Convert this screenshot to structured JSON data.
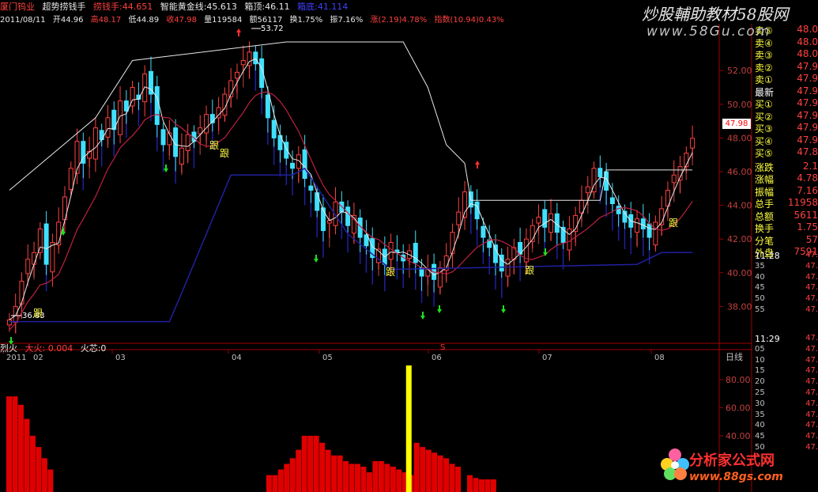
{
  "header": {
    "stock_name": "厦门钨业",
    "indicator_name": "超势捞钱手",
    "lao_qian_shou": "捞钱手:44.651",
    "zhineng_huangjin": "智能黄金线:45.613",
    "xiang_ding": "箱顶:46.11",
    "extra": "箱底:41.114"
  },
  "quote_line": {
    "date": "2011/08/11",
    "open": "开44.96",
    "high": "高48.17",
    "low": "低44.89",
    "close": "收47.98",
    "volume": "量119584",
    "amount": "额56117",
    "turnover": "换1.75%",
    "amplitude": "振7.16%",
    "change": "涨(2.19)4.78%",
    "index": "指数(10.94)0.43%"
  },
  "watermarks": {
    "top_cn": "炒股輔助教材58股网",
    "top_url": "www.58Gu.com",
    "bottom_cn": "分析家公式网",
    "bottom_url": "www.88gs.com"
  },
  "chart_labels": {
    "high_annot": "53.72",
    "low_annot": "36.83",
    "current_price_tag": "47.98",
    "period_label": "日线",
    "gen_label": "跟",
    "sell_mark": "S"
  },
  "lower_header": {
    "name": "烈火",
    "sub": "大火: 0.004",
    "core": "火芯:0"
  },
  "colors": {
    "up": "#ff4040",
    "down": "#40e0ff",
    "background": "#000000",
    "axis": "#a00000",
    "blue_line": "#2020a0",
    "white_line": "#e8e8e8",
    "red_bar": "#e00000",
    "yellow_bar": "#ffff00"
  },
  "quote_panel": {
    "asks": [
      {
        "label": "卖⑤",
        "value": "48.0"
      },
      {
        "label": "卖④",
        "value": "48.0"
      },
      {
        "label": "卖③",
        "value": "48.0"
      },
      {
        "label": "卖②",
        "value": "47.9"
      },
      {
        "label": "卖①",
        "value": "47.9"
      }
    ],
    "last": {
      "label": "最新",
      "value": "47.9"
    },
    "bids": [
      {
        "label": "买①",
        "value": "47.9"
      },
      {
        "label": "买②",
        "value": "47.9"
      },
      {
        "label": "买③",
        "value": "47.9"
      },
      {
        "label": "买④",
        "value": "47.9"
      },
      {
        "label": "买⑤",
        "value": "47.8"
      }
    ],
    "stats": [
      {
        "label": "涨跌",
        "value": "2.1"
      },
      {
        "label": "涨幅",
        "value": "4.78"
      },
      {
        "label": "振幅",
        "value": "7.16"
      },
      {
        "label": "总手",
        "value": "11958"
      },
      {
        "label": "总额",
        "value": "5611"
      },
      {
        "label": "换手",
        "value": "1.75"
      },
      {
        "label": "分笔",
        "value": "57"
      },
      {
        "label": "外盘",
        "value": "7591"
      }
    ],
    "ticks1_time": "11:28",
    "ticks1": [
      {
        "label": "",
        "value": "47."
      },
      {
        "label": "35",
        "value": "47."
      },
      {
        "label": "40",
        "value": "47."
      },
      {
        "label": "45",
        "value": "47."
      },
      {
        "label": "50",
        "value": "47."
      },
      {
        "label": "55",
        "value": "47."
      }
    ],
    "ticks2_time": "11:29",
    "ticks2": [
      {
        "label": "",
        "value": "47."
      },
      {
        "label": "05",
        "value": "47."
      },
      {
        "label": "10",
        "value": "47."
      },
      {
        "label": "15",
        "value": "47."
      },
      {
        "label": "20",
        "value": "47."
      },
      {
        "label": "25",
        "value": "47."
      },
      {
        "label": "30",
        "value": "47."
      },
      {
        "label": "35",
        "value": "47."
      },
      {
        "label": "40",
        "value": "47."
      },
      {
        "label": "45",
        "value": "47."
      },
      {
        "label": "50",
        "value": "47."
      }
    ]
  },
  "chart_data": [
    {
      "type": "candlestick",
      "title": "",
      "x_labels": [
        "2011",
        "02",
        "03",
        "04",
        "05",
        "06",
        "07",
        "08"
      ],
      "y_ticks": [
        38.0,
        40.0,
        42.0,
        44.0,
        46.0,
        48.0,
        50.0,
        52.0
      ],
      "ylim": [
        36.0,
        54.5
      ],
      "closes": [
        37.2,
        38.0,
        39.5,
        40.8,
        41.2,
        42.6,
        40.5,
        41.8,
        43.0,
        44.5,
        46.2,
        47.8,
        46.5,
        47.2,
        48.6,
        47.9,
        49.2,
        48.5,
        50.2,
        49.6,
        51.0,
        50.3,
        51.8,
        50.6,
        48.8,
        47.6,
        48.3,
        46.9,
        47.4,
        48.2,
        47.8,
        48.6,
        49.4,
        48.9,
        49.8,
        50.6,
        51.4,
        51.9,
        52.6,
        53.1,
        52.4,
        51.0,
        49.2,
        48.0,
        47.3,
        46.8,
        46.2,
        47.0,
        45.6,
        44.9,
        43.7,
        42.5,
        43.1,
        44.2,
        43.6,
        42.8,
        43.4,
        42.1,
        41.6,
        40.9,
        41.4,
        40.5,
        41.8,
        41.2,
        40.7,
        41.3,
        40.6,
        39.8,
        40.2,
        39.6,
        40.3,
        41.0,
        42.4,
        43.6,
        44.8,
        43.9,
        43.2,
        42.1,
        41.5,
        40.6,
        40.1,
        40.8,
        41.5,
        41.1,
        42.0,
        42.8,
        43.3,
        42.7,
        43.5,
        42.4,
        41.8,
        42.6,
        43.4,
        44.3,
        45.1,
        46.2,
        45.7,
        44.9,
        44.1,
        43.5,
        43.0,
        42.7,
        43.2,
        42.6,
        42.1,
        43.0,
        43.8,
        44.9,
        45.8,
        46.3,
        47.1,
        47.98
      ],
      "series": [
        {
          "name": "捞钱手",
          "current": 44.651
        },
        {
          "name": "智能黄金线",
          "current": 45.613
        },
        {
          "name": "箱顶",
          "current": 46.11
        }
      ],
      "high_annotation": 53.72,
      "low_annotation": 36.83
    },
    {
      "type": "bar",
      "title": "烈火",
      "y_ticks": [
        40.0,
        60.0,
        80.0
      ],
      "ylim": [
        0,
        90
      ],
      "red_bars": [
        {
          "start": 0,
          "values": [
            68,
            68,
            62,
            52,
            40,
            32,
            24,
            16
          ]
        },
        {
          "start": 44,
          "values": [
            12,
            12,
            16,
            20,
            24,
            30,
            40,
            40,
            40,
            35,
            30,
            26,
            26,
            22,
            20,
            20,
            18,
            14
          ]
        },
        {
          "start": 62,
          "values": [
            22,
            22,
            20,
            18,
            16,
            14,
            12
          ]
        },
        {
          "start": 69,
          "values": [
            35,
            32,
            30,
            28,
            26,
            24,
            20,
            18
          ]
        },
        {
          "start": 78,
          "values": [
            12,
            10,
            9,
            9,
            9
          ]
        }
      ],
      "yellow_bar": {
        "index": 66,
        "value": 90
      }
    }
  ]
}
